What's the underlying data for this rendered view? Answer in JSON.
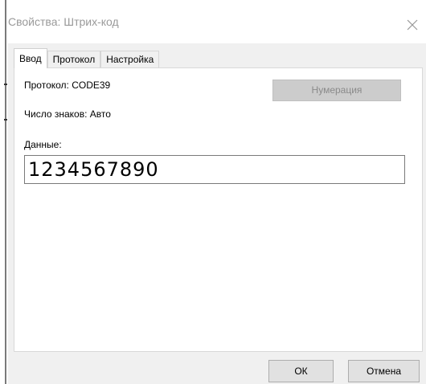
{
  "window": {
    "title": "Свойства: Штрих-код"
  },
  "tabs": [
    {
      "label": "Ввод",
      "active": true
    },
    {
      "label": "Протокол",
      "active": false
    },
    {
      "label": "Настройка",
      "active": false
    }
  ],
  "main": {
    "protocol_text": "Протокол: CODE39",
    "char_count_text": "Число знаков: Авто",
    "numbering_label": "Нумерация",
    "numbering_enabled": false,
    "data_label": "Данные:",
    "data_value": "1234567890"
  },
  "footer": {
    "ok_label": "ОК",
    "cancel_label": "Отмена"
  },
  "icons": {
    "close": "close-icon"
  },
  "colors": {
    "dialog_background": "#f0f0f0",
    "panel_background": "#ffffff",
    "title_text": "#9a9a9a",
    "disabled_button": "#cccccc"
  }
}
